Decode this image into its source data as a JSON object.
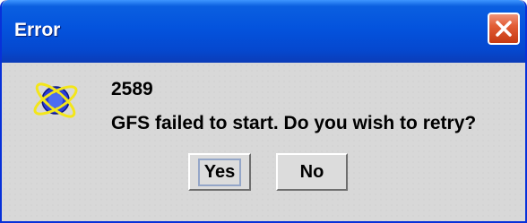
{
  "dialog": {
    "title": "Error",
    "close_icon": "close-x-icon",
    "message_icon": "atom-orbit-icon",
    "code": "2589",
    "message": "GFS failed to start.  Do you wish to retry?",
    "buttons": {
      "yes_label": "Yes",
      "no_label": "No"
    }
  },
  "colors": {
    "titlebar": "#0453dd",
    "close_button": "#e25d35",
    "body": "#d8d8d8"
  }
}
